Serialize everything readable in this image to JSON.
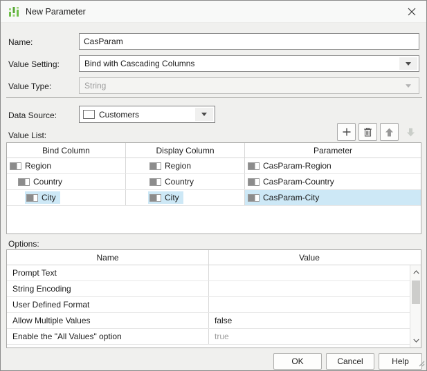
{
  "window": {
    "title": "New Parameter",
    "icon": "parameter-sliders-icon",
    "close_icon": "close-x-icon"
  },
  "fields": {
    "name_label": "Name:",
    "name_value": "CasParam",
    "value_setting_label": "Value Setting:",
    "value_setting_value": "Bind with Cascading Columns",
    "value_type_label": "Value Type:",
    "value_type_value": "String",
    "value_type_disabled": true,
    "data_source_label": "Data Source:",
    "data_source_value": "Customers",
    "data_source_icon": "table-icon"
  },
  "value_list": {
    "label": "Value List:",
    "toolbar": [
      {
        "name": "add",
        "icon": "plus-icon",
        "enabled": true
      },
      {
        "name": "delete",
        "icon": "trash-icon",
        "enabled": true
      },
      {
        "name": "move-up",
        "icon": "arrow-up-icon",
        "enabled": true
      },
      {
        "name": "move-down",
        "icon": "arrow-down-icon",
        "enabled": false
      }
    ],
    "columns": [
      "Bind Column",
      "Display Column",
      "Parameter"
    ],
    "rows": [
      {
        "bind": "Region",
        "display": "Region",
        "parameter": "CasParam-Region",
        "indent": 0,
        "selected": false
      },
      {
        "bind": "Country",
        "display": "Country",
        "parameter": "CasParam-Country",
        "indent": 1,
        "selected": false
      },
      {
        "bind": "City",
        "display": "City",
        "parameter": "CasParam-City",
        "indent": 2,
        "selected": true
      }
    ]
  },
  "options": {
    "label": "Options:",
    "columns": [
      "Name",
      "Value"
    ],
    "rows": [
      {
        "name": "Prompt Text",
        "value": "",
        "muted": false
      },
      {
        "name": "String Encoding",
        "value": "",
        "muted": false
      },
      {
        "name": "User Defined Format",
        "value": "",
        "muted": false
      },
      {
        "name": "Allow Multiple Values",
        "value": "false",
        "muted": false
      },
      {
        "name": "Enable the \"All Values\" option",
        "value": "true",
        "muted": true
      }
    ]
  },
  "buttons": {
    "ok": "OK",
    "cancel": "Cancel",
    "help": "Help"
  },
  "colors": {
    "selection": "#cde8f6",
    "accent_green": "#6abf4b",
    "dialog_bg": "#f0f0ee",
    "disabled_text": "#9b9b9b"
  }
}
